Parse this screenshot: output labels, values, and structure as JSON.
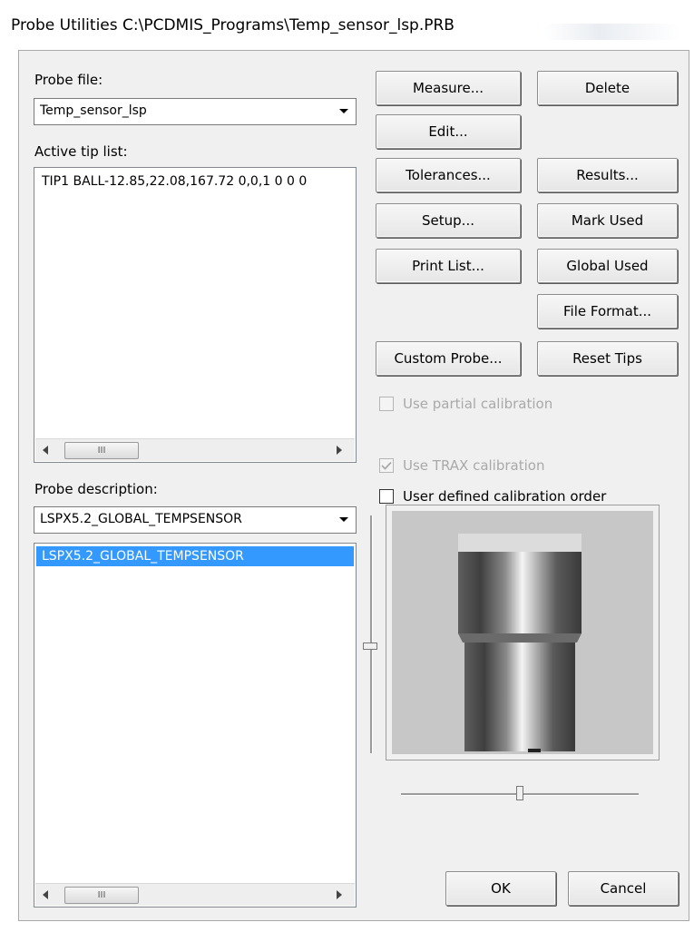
{
  "window": {
    "title": "Probe Utilities  C:\\PCDMIS_Programs\\Temp_sensor_lsp.PRB"
  },
  "probe_file": {
    "label": "Probe file:",
    "value": "Temp_sensor_lsp"
  },
  "active_tip_list": {
    "label": "Active tip list:",
    "items": [
      "TIP1 BALL-12.85,22.08,167.72 0,0,1  0  0  0"
    ],
    "scroll_thumb_glyph": "III"
  },
  "probe_description": {
    "label": "Probe description:",
    "value": "LSPX5.2_GLOBAL_TEMPSENSOR",
    "items": [
      "LSPX5.2_GLOBAL_TEMPSENSOR"
    ],
    "selected_index": 0,
    "scroll_thumb_glyph": "III"
  },
  "buttons": {
    "measure": "Measure...",
    "delete": "Delete",
    "edit": "Edit...",
    "tolerances": "Tolerances...",
    "results": "Results...",
    "setup": "Setup...",
    "mark_used": "Mark Used",
    "print_list": "Print List...",
    "global_used": "Global Used",
    "file_format": "File Format...",
    "custom_probe": "Custom Probe...",
    "reset_tips": "Reset Tips",
    "ok": "OK",
    "cancel": "Cancel"
  },
  "options": {
    "use_partial_calibration": {
      "label": "Use partial calibration",
      "checked": false,
      "enabled": false
    },
    "use_trax_calibration": {
      "label": "Use TRAX calibration",
      "checked": true,
      "enabled": false
    },
    "user_defined_calibration_order": {
      "label": "User defined calibration order",
      "checked": false,
      "enabled": true
    }
  },
  "colors": {
    "selection": "#3399ff",
    "dialog_bg": "#f0f0f0",
    "preview_bg": "#c7c7c7"
  }
}
